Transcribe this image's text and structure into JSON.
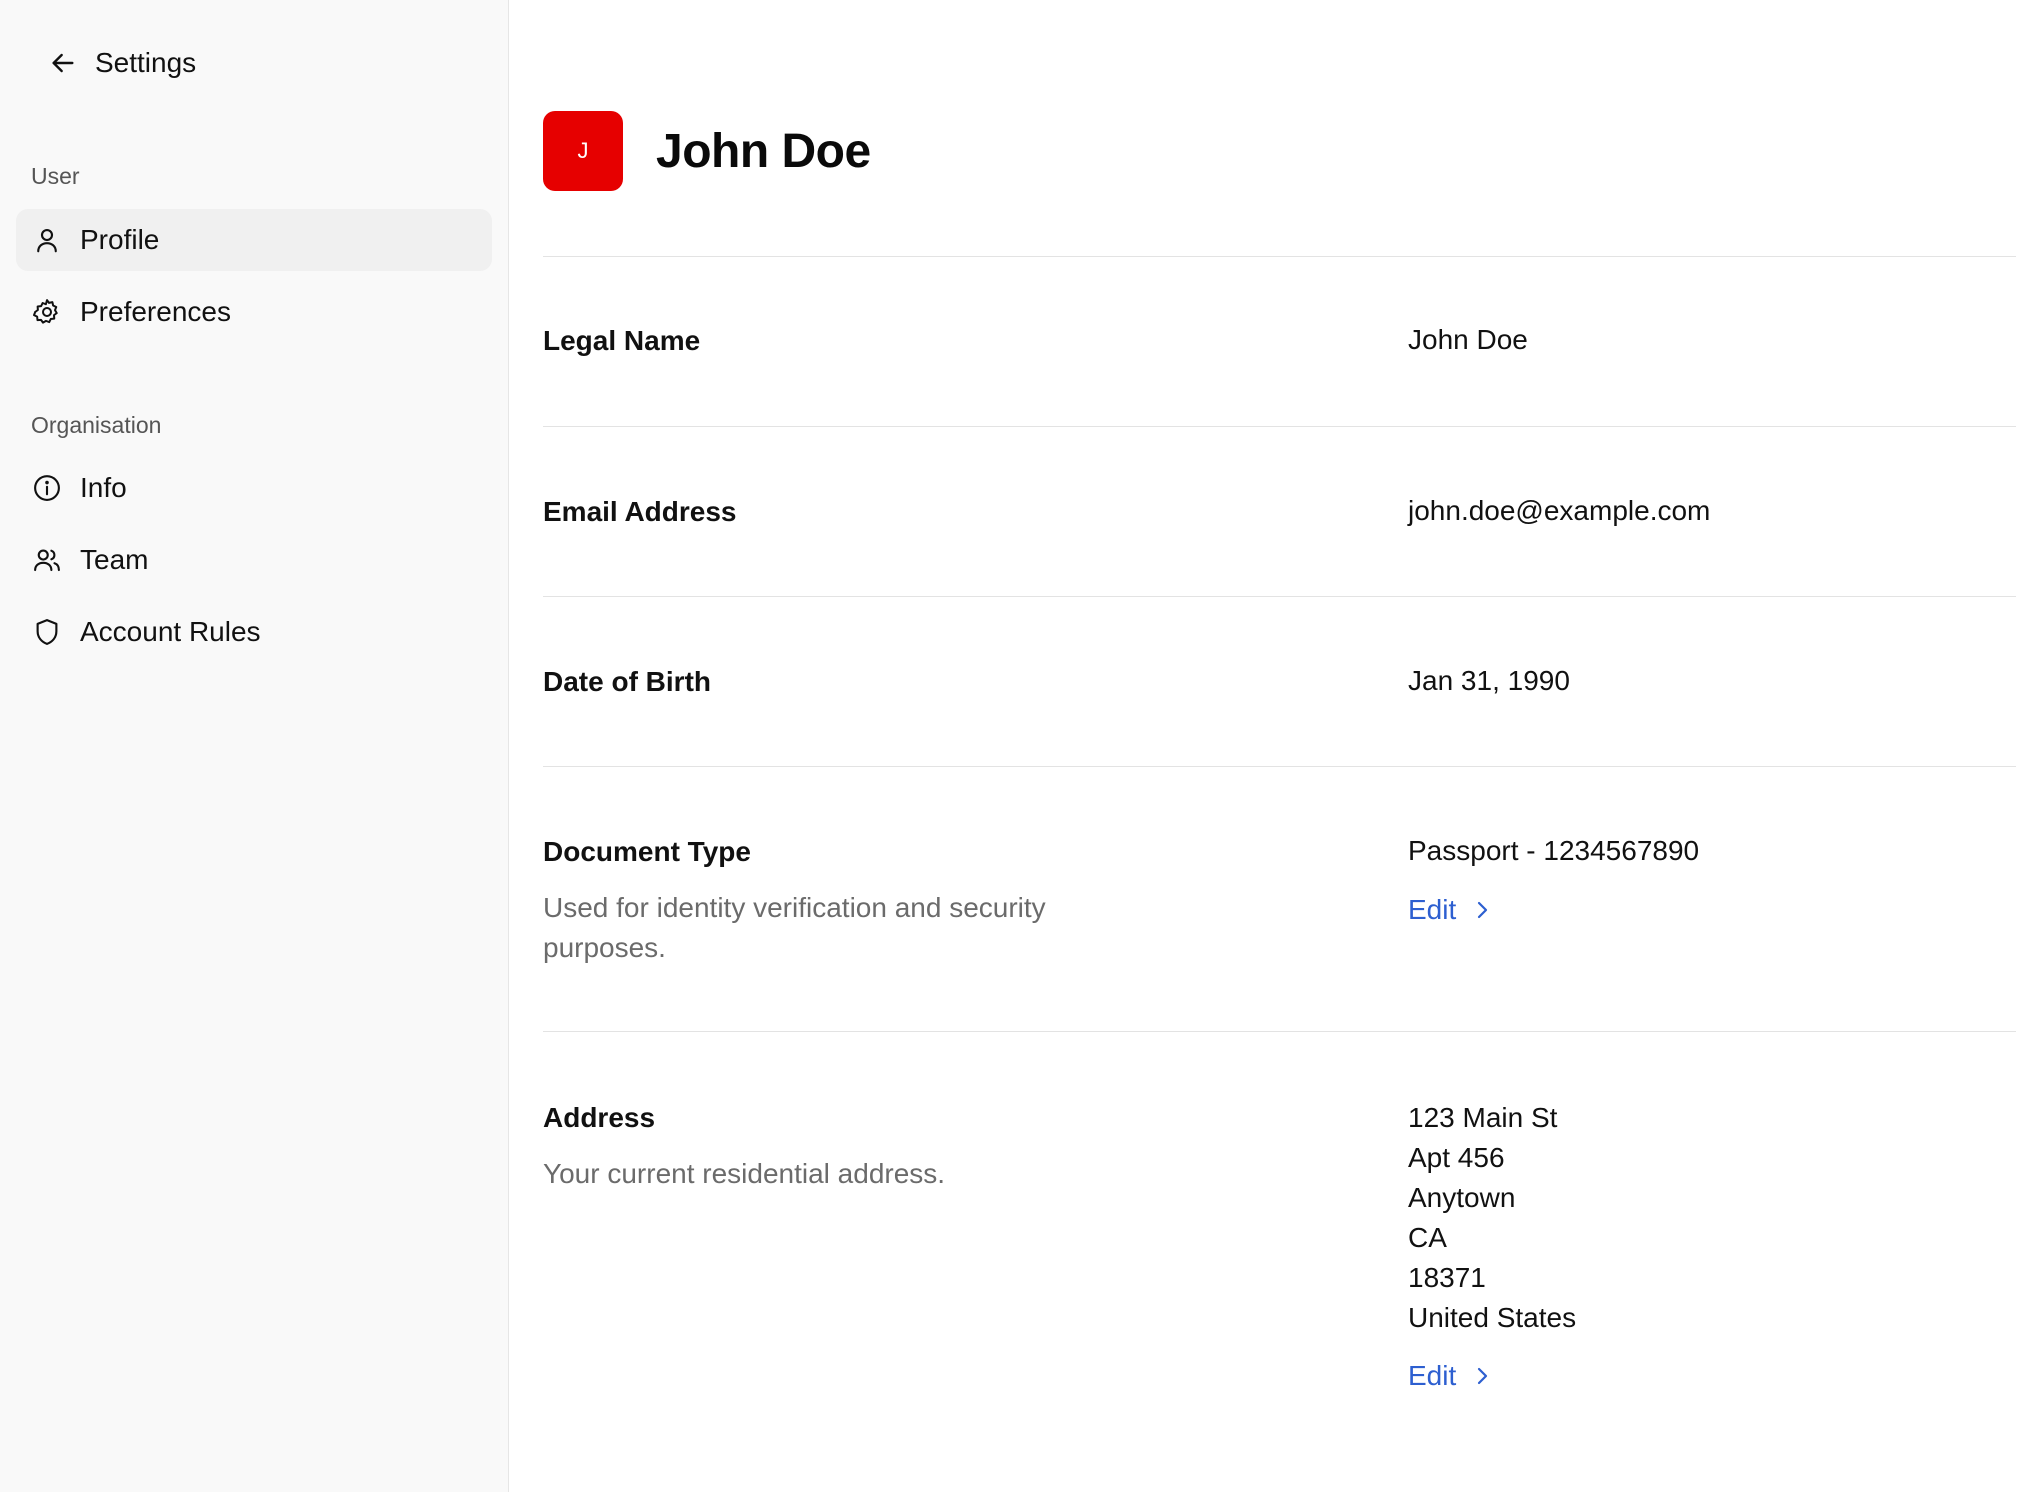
{
  "sidebar": {
    "back_label": "Settings",
    "sections": [
      {
        "label": "User",
        "items": [
          {
            "label": "Profile",
            "icon": "user-icon",
            "active": true
          },
          {
            "label": "Preferences",
            "icon": "gear-icon",
            "active": false
          }
        ]
      },
      {
        "label": "Organisation",
        "items": [
          {
            "label": "Info",
            "icon": "info-icon",
            "active": false
          },
          {
            "label": "Team",
            "icon": "team-icon",
            "active": false
          },
          {
            "label": "Account Rules",
            "icon": "shield-icon",
            "active": false
          }
        ]
      }
    ]
  },
  "profile": {
    "avatar_initial": "J",
    "avatar_color": "#e60000",
    "name": "John Doe"
  },
  "fields": {
    "legal_name": {
      "label": "Legal Name",
      "value": "John Doe"
    },
    "email": {
      "label": "Email Address",
      "value": "john.doe@example.com"
    },
    "dob": {
      "label": "Date of Birth",
      "value": "Jan 31, 1990"
    },
    "document": {
      "label": "Document Type",
      "description": "Used for identity verification and security purposes.",
      "value": "Passport - 1234567890",
      "edit_label": "Edit"
    },
    "address": {
      "label": "Address",
      "description": "Your current residential address.",
      "lines": [
        "123 Main St",
        "Apt 456",
        "Anytown",
        "CA",
        "18371",
        "United States"
      ],
      "edit_label": "Edit"
    }
  },
  "colors": {
    "link": "#2d5fd0",
    "active_nav_bg": "#f0f0f0",
    "sidebar_bg": "#f9f9f9"
  }
}
